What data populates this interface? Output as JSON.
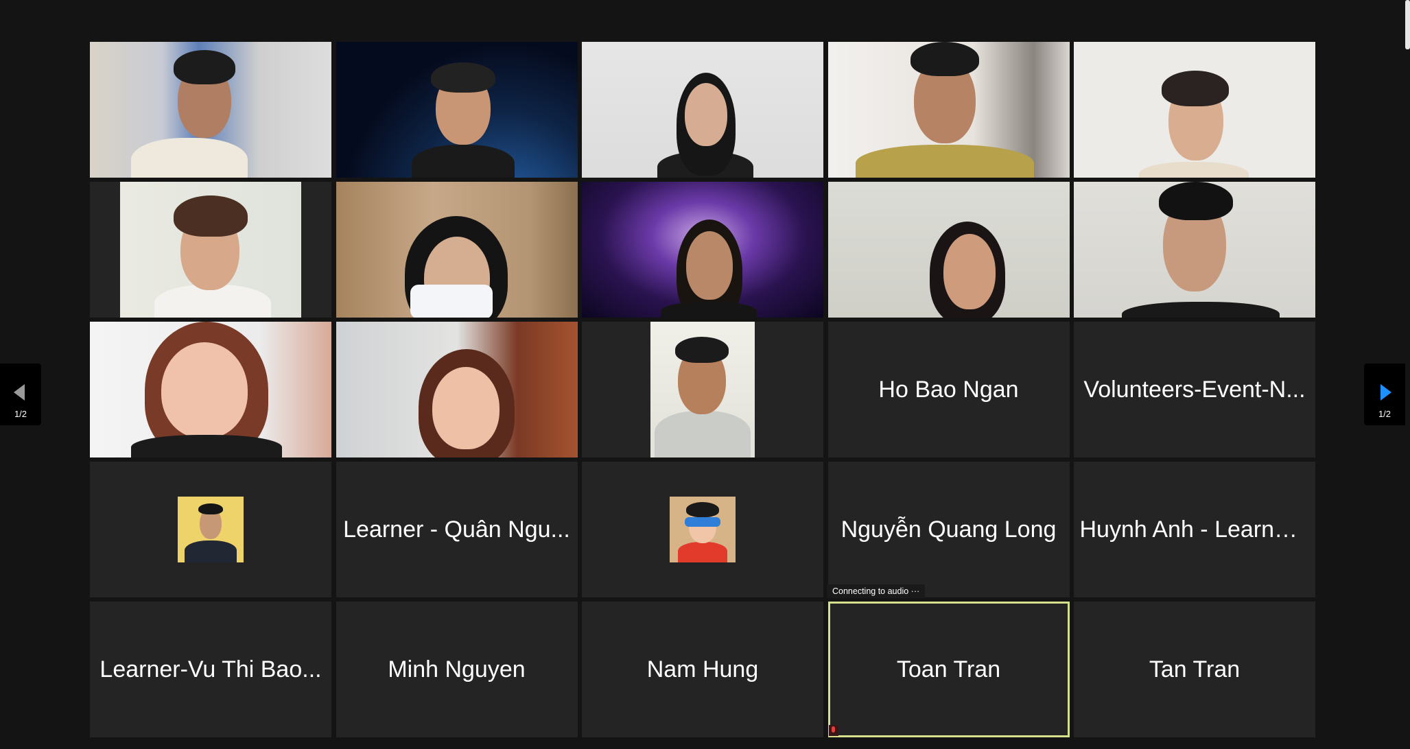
{
  "gallery": {
    "page_indicator": "1/2",
    "audio_status": "Connecting to audio ···",
    "tiles": [
      {
        "type": "video",
        "name": ""
      },
      {
        "type": "video",
        "name": ""
      },
      {
        "type": "video",
        "name": ""
      },
      {
        "type": "video",
        "name": ""
      },
      {
        "type": "video",
        "name": ""
      },
      {
        "type": "video",
        "name": ""
      },
      {
        "type": "video",
        "name": ""
      },
      {
        "type": "video",
        "name": ""
      },
      {
        "type": "video",
        "name": ""
      },
      {
        "type": "video",
        "name": ""
      },
      {
        "type": "video",
        "name": ""
      },
      {
        "type": "video",
        "name": ""
      },
      {
        "type": "video",
        "name": ""
      },
      {
        "type": "name",
        "name": "Ho Bao Ngan"
      },
      {
        "type": "name",
        "name": "Volunteers-Event-N..."
      },
      {
        "type": "avatar",
        "name": ""
      },
      {
        "type": "name",
        "name": "Learner - Quân Ngu..."
      },
      {
        "type": "avatar",
        "name": ""
      },
      {
        "type": "name",
        "name": "Nguyễn Quang Long"
      },
      {
        "type": "name",
        "name": "Huynh Anh - Learner..."
      },
      {
        "type": "name",
        "name": "Learner-Vu Thi Bao..."
      },
      {
        "type": "name",
        "name": "Minh Nguyen"
      },
      {
        "type": "name",
        "name": "Nam Hung"
      },
      {
        "type": "name",
        "name": "Toan Tran"
      },
      {
        "type": "name",
        "name": "Tan Tran"
      }
    ]
  },
  "colors": {
    "background": "#141414",
    "tile": "#242424",
    "active_speaker_border": "#d6e08a",
    "next_page_arrow": "#1e90ff",
    "prev_page_arrow": "#9a9a9a"
  },
  "icons": [
    "chevron-left-icon",
    "chevron-right-icon",
    "muted-mic-icon"
  ]
}
